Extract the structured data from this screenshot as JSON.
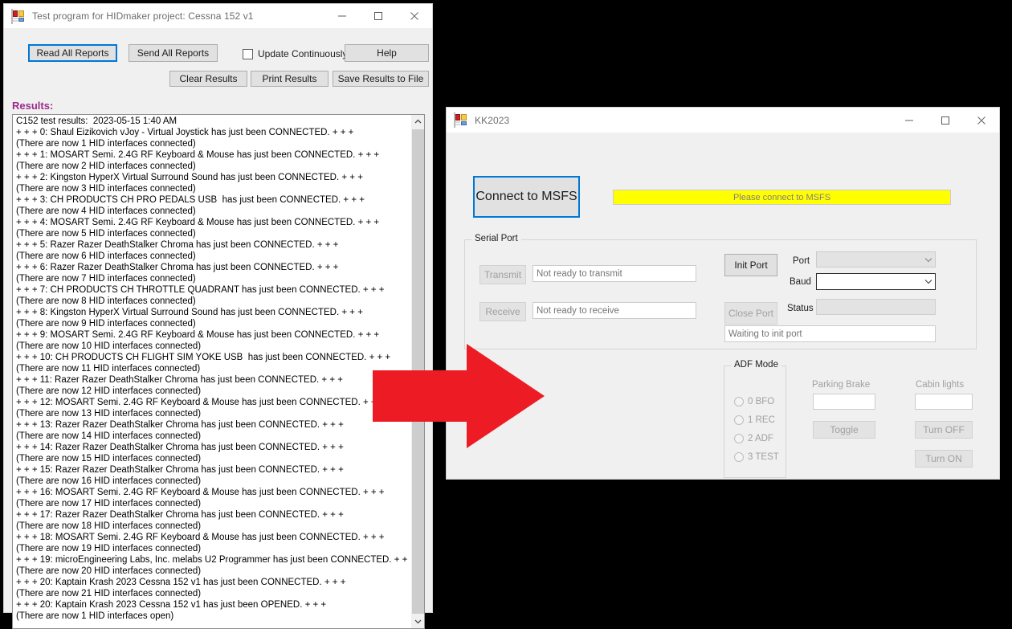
{
  "window_hid": {
    "title": "Test program for HIDmaker project: Cessna 152 v1",
    "icon": "vb-form-icon",
    "controls": {
      "minimize": "–",
      "maximize": "□",
      "close": "✕"
    },
    "toolbar": {
      "read_all_reports": "Read All Reports",
      "send_all_reports": "Send All Reports",
      "update_continuously": "Update Continuously",
      "update_continuously_checked": false,
      "help": "Help",
      "clear_results": "Clear Results",
      "print_results": "Print Results",
      "save_results_to_file": "Save Results to File"
    },
    "results_label": "Results:",
    "results_label_color": "#9c2a8c",
    "results_text": "C152 test results:  2023-05-15 1:40 AM\n+ + + 0: Shaul Eizikovich vJoy - Virtual Joystick has just been CONNECTED. + + +\n(There are now 1 HID interfaces connected)\n+ + + 1: MOSART Semi. 2.4G RF Keyboard & Mouse has just been CONNECTED. + + +\n(There are now 2 HID interfaces connected)\n+ + + 2: Kingston HyperX Virtual Surround Sound has just been CONNECTED. + + +\n(There are now 3 HID interfaces connected)\n+ + + 3: CH PRODUCTS CH PRO PEDALS USB  has just been CONNECTED. + + +\n(There are now 4 HID interfaces connected)\n+ + + 4: MOSART Semi. 2.4G RF Keyboard & Mouse has just been CONNECTED. + + +\n(There are now 5 HID interfaces connected)\n+ + + 5: Razer Razer DeathStalker Chroma has just been CONNECTED. + + +\n(There are now 6 HID interfaces connected)\n+ + + 6: Razer Razer DeathStalker Chroma has just been CONNECTED. + + +\n(There are now 7 HID interfaces connected)\n+ + + 7: CH PRODUCTS CH THROTTLE QUADRANT has just been CONNECTED. + + +\n(There are now 8 HID interfaces connected)\n+ + + 8: Kingston HyperX Virtual Surround Sound has just been CONNECTED. + + +\n(There are now 9 HID interfaces connected)\n+ + + 9: MOSART Semi. 2.4G RF Keyboard & Mouse has just been CONNECTED. + + +\n(There are now 10 HID interfaces connected)\n+ + + 10: CH PRODUCTS CH FLIGHT SIM YOKE USB  has just been CONNECTED. + + +\n(There are now 11 HID interfaces connected)\n+ + + 11: Razer Razer DeathStalker Chroma has just been CONNECTED. + + +\n(There are now 12 HID interfaces connected)\n+ + + 12: MOSART Semi. 2.4G RF Keyboard & Mouse has just been CONNECTED. + + +\n(There are now 13 HID interfaces connected)\n+ + + 13: Razer Razer DeathStalker Chroma has just been CONNECTED. + + +\n(There are now 14 HID interfaces connected)\n+ + + 14: Razer Razer DeathStalker Chroma has just been CONNECTED. + + +\n(There are now 15 HID interfaces connected)\n+ + + 15: Razer Razer DeathStalker Chroma has just been CONNECTED. + + +\n(There are now 16 HID interfaces connected)\n+ + + 16: MOSART Semi. 2.4G RF Keyboard & Mouse has just been CONNECTED. + + +\n(There are now 17 HID interfaces connected)\n+ + + 17: Razer Razer DeathStalker Chroma has just been CONNECTED. + + +\n(There are now 18 HID interfaces connected)\n+ + + 18: MOSART Semi. 2.4G RF Keyboard & Mouse has just been CONNECTED. + + +\n(There are now 19 HID interfaces connected)\n+ + + 19: microEngineering Labs, Inc. melabs U2 Programmer has just been CONNECTED. + + +\n(There are now 20 HID interfaces connected)\n+ + + 20: Kaptain Krash 2023 Cessna 152 v1 has just been CONNECTED. + + +\n(There are now 21 HID interfaces connected)\n+ + + 20: Kaptain Krash 2023 Cessna 152 v1 has just been OPENED. + + +\n(There are now 1 HID interfaces open)",
    "scrollbar": {
      "up_arrow": "⌃",
      "down_arrow": "⌄"
    }
  },
  "window_kk": {
    "title": "KK2023",
    "icon": "vb-form-icon",
    "controls": {
      "minimize": "–",
      "maximize": "□",
      "close": "✕"
    },
    "connect_button": "Connect to MSFS",
    "status_banner": "Please connect to MSFS",
    "status_banner_bg": "#ffff00",
    "serial_port": {
      "group_title": "Serial Port",
      "transmit_button": "Transmit",
      "transmit_value": "Not ready to transmit",
      "receive_button": "Receive",
      "receive_value": "Not ready to receive",
      "init_port_button": "Init Port",
      "close_port_button": "Close Port",
      "port_label": "Port",
      "port_value": "",
      "baud_label": "Baud",
      "baud_value": "",
      "status_label": "Status",
      "status_value": "",
      "init_status": "Waiting to init port",
      "chevron": "⌄"
    },
    "adf_mode": {
      "group_title": "ADF Mode",
      "options": [
        {
          "label": "0 BFO",
          "selected": false
        },
        {
          "label": "1 REC",
          "selected": false
        },
        {
          "label": "2 ADF",
          "selected": false
        },
        {
          "label": "3 TEST",
          "selected": false
        }
      ]
    },
    "parking_brake": {
      "label": "Parking Brake",
      "value": "",
      "toggle_button": "Toggle"
    },
    "cabin_lights": {
      "label": "Cabin lights",
      "value": "",
      "turn_off_button": "Turn OFF",
      "turn_on_button": "Turn ON"
    }
  },
  "annotation": {
    "arrow": "red-right-arrow",
    "arrow_color": "#ed1c24"
  }
}
